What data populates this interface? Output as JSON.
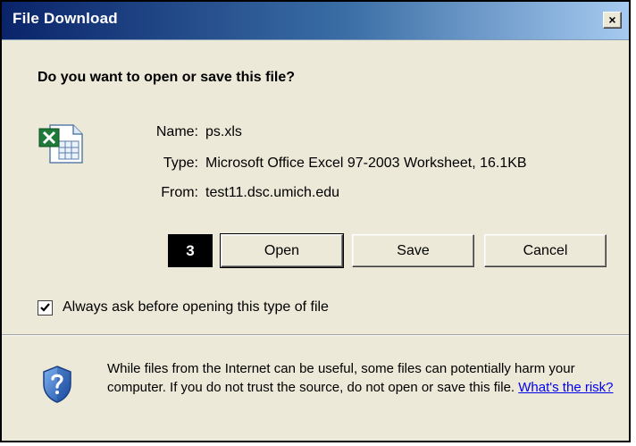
{
  "window": {
    "title": "File Download",
    "close_glyph": "×"
  },
  "prompt": {
    "question": "Do you want to open or save this file?"
  },
  "file": {
    "icon": "excel-file-icon",
    "name_label": "Name:",
    "name_value": "ps.xls",
    "type_label": "Type:",
    "type_value": "Microsoft Office Excel 97-2003 Worksheet, 16.1KB",
    "from_label": "From:",
    "from_value": "test11.dsc.umich.edu"
  },
  "step_badge": "3",
  "buttons": {
    "open": "Open",
    "save": "Save",
    "cancel": "Cancel"
  },
  "checkbox": {
    "checked": true,
    "label": "Always ask before opening this type of file"
  },
  "warning": {
    "icon": "shield-question-icon",
    "text": "While files from the Internet can be useful, some files can potentially harm your computer. If you do not trust the source, do not open or save this file.",
    "link": "What's the risk?"
  },
  "colors": {
    "titlebar_start": "#0a246a",
    "titlebar_end": "#a6caf0",
    "dialog_bg": "#ece9d8",
    "link": "#0000ee"
  }
}
